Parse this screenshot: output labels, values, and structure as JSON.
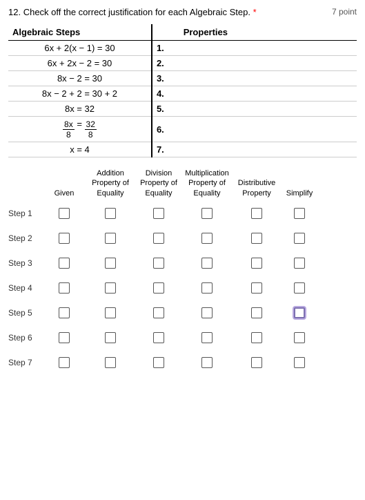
{
  "question": {
    "number": "12.",
    "text": "Check off the correct justification for each Algebraic Step.",
    "required": "*",
    "points": "7 point"
  },
  "table": {
    "col1_header": "Algebraic Steps",
    "col2_header": "Properties",
    "rows": [
      {
        "num": "1.",
        "step": "6x + 2(x − 1) = 30"
      },
      {
        "num": "2.",
        "step": "6x + 2x − 2 = 30"
      },
      {
        "num": "3.",
        "step": "8x − 2 = 30"
      },
      {
        "num": "4.",
        "step": "8x − 2 + 2 = 30 + 2"
      },
      {
        "num": "5.",
        "step": "8x = 32"
      },
      {
        "num": "6.",
        "step": "8x/8 = 32/8"
      },
      {
        "num": "7.",
        "step": "x = 4"
      }
    ]
  },
  "columns": {
    "given": "Given",
    "addition": "Addition Property of Equality",
    "division": "Division Property of Equality",
    "multiplication": "Multiplication Property of Equality",
    "distributive": "Distributive Property",
    "simplify": "Simplify"
  },
  "steps": [
    {
      "label": "Step 1"
    },
    {
      "label": "Step 2"
    },
    {
      "label": "Step 3"
    },
    {
      "label": "Step 4"
    },
    {
      "label": "Step 5"
    },
    {
      "label": "Step 6"
    },
    {
      "label": "Step 7"
    }
  ]
}
